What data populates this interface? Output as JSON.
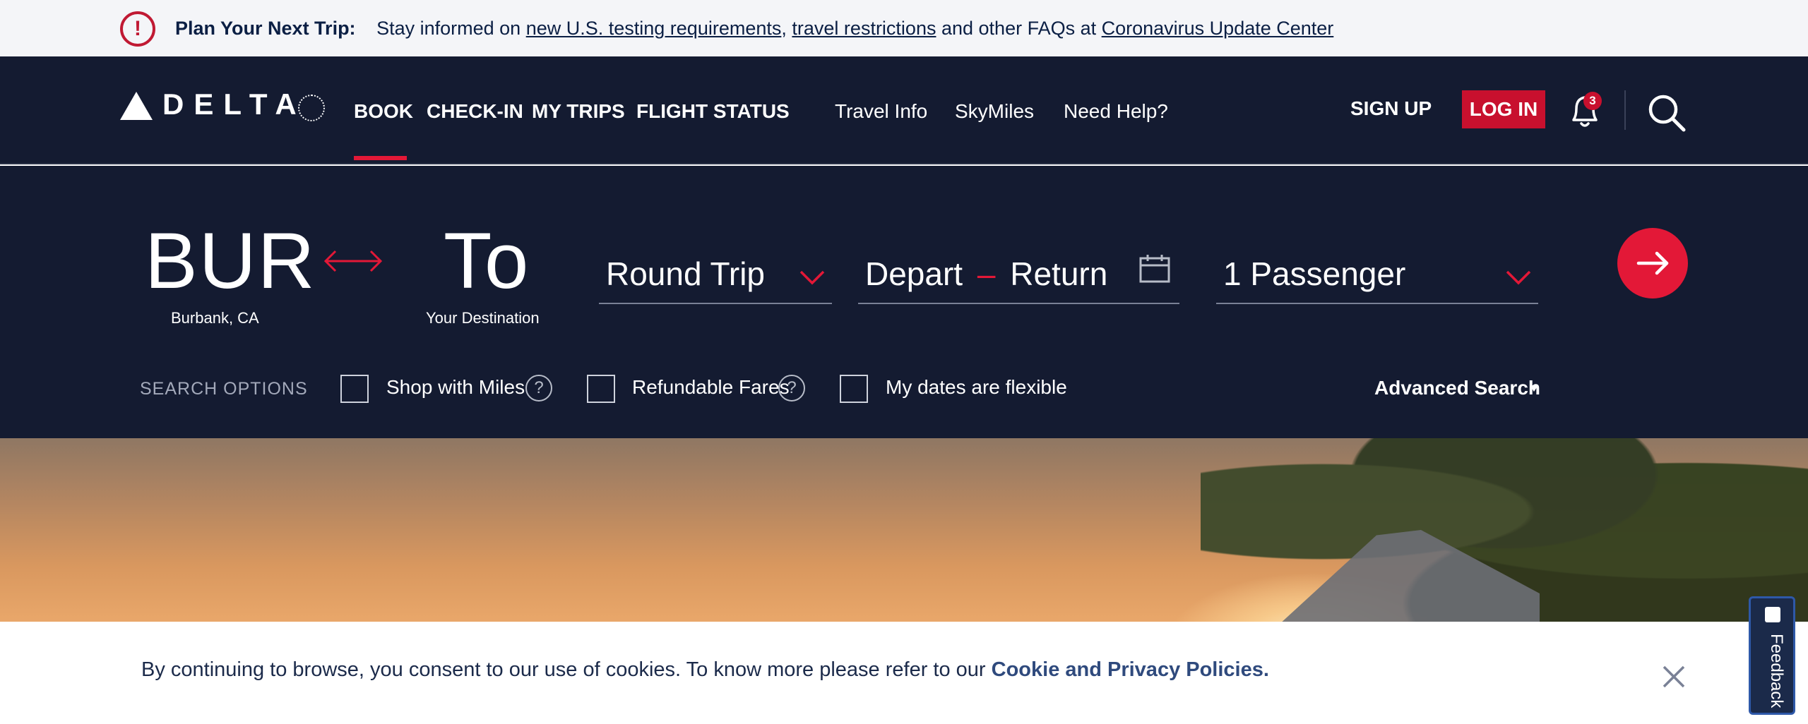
{
  "alert": {
    "title": "Plan Your Next Trip:",
    "lead": "Stay informed on",
    "link1": "new U.S. testing requirements",
    "sep": ",",
    "link2": "travel restrictions",
    "mid": "and other FAQs at",
    "link3": "Coronavirus Update Center"
  },
  "brand": {
    "name": "DELTA"
  },
  "nav": {
    "primary": [
      "BOOK",
      "CHECK-IN",
      "MY TRIPS",
      "FLIGHT STATUS"
    ],
    "secondary": [
      "Travel Info",
      "SkyMiles",
      "Need Help?"
    ],
    "sign_up": "SIGN UP",
    "log_in": "LOG IN",
    "notifications_count": "3"
  },
  "booking": {
    "from_code": "BUR",
    "from_city": "Burbank, CA",
    "to_code": "To",
    "to_label": "Your Destination",
    "trip_type": "Round Trip",
    "depart": "Depart",
    "dash": "–",
    "return": "Return",
    "passengers": "1 Passenger",
    "search_options_label": "SEARCH OPTIONS",
    "options": {
      "shop_with_miles": "Shop with Miles",
      "refundable": "Refundable Fares",
      "flexible": "My dates are flexible"
    },
    "help_glyph": "?",
    "advanced_search": "Advanced Search"
  },
  "cookie": {
    "text": "By continuing to browse, you consent to our use of cookies. To know more please refer to our",
    "link": "Cookie and Privacy Policies."
  },
  "feedback": {
    "label": "Feedback"
  },
  "colors": {
    "navy": "#141b31",
    "accent_red": "#e31837",
    "alert_red": "#c01933",
    "link_navy": "#0b1f44"
  }
}
